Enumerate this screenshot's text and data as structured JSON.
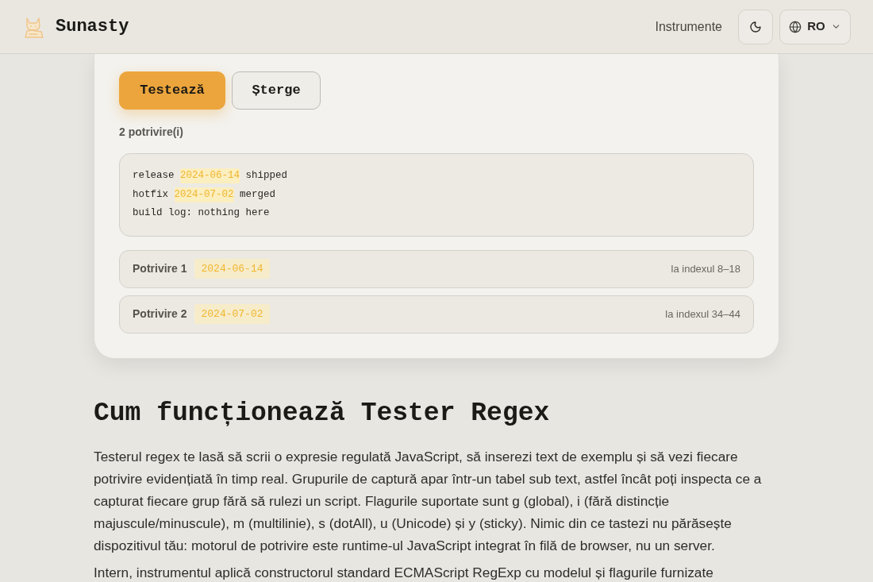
{
  "header": {
    "brand": "Sunasty",
    "nav_link": "Instrumente",
    "language": "RO"
  },
  "actions": [
    {
      "label": "Testează",
      "kind": "primary"
    },
    {
      "label": "Șterge",
      "kind": "secondary"
    }
  ],
  "match_count": "2 potrivire(i)",
  "test_text": [
    [
      {
        "text": "release ",
        "highlighted": false
      },
      {
        "text": "2024-06-14",
        "highlighted": true
      },
      {
        "text": " shipped",
        "highlighted": false
      }
    ],
    [
      {
        "text": "hotfix ",
        "highlighted": false
      },
      {
        "text": "2024-07-02",
        "highlighted": true
      },
      {
        "text": " merged",
        "highlighted": false
      }
    ],
    [
      {
        "text": "build log: nothing here",
        "highlighted": false
      }
    ]
  ],
  "matches": [
    {
      "label": "Potrivire 1",
      "value": "2024-06-14",
      "position": "la indexul 8–18"
    },
    {
      "label": "Potrivire 2",
      "value": "2024-07-02",
      "position": "la indexul 34–44"
    }
  ],
  "article": {
    "heading": "Cum funcționează Tester Regex",
    "paragraphs": [
      "Testerul regex te lasă să scrii o expresie regulată JavaScript, să inserezi text de exemplu și să vezi fiecare potrivire evidențiată în timp real. Grupurile de captură apar într-un tabel sub text, astfel încât poți inspecta ce a capturat fiecare grup fără să rulezi un script. Flagurile suportate sunt g (global), i (fără distincție majuscule/minuscule), m (multilinie), s (dotAll), u (Unicode) și y (sticky). Nimic din ce tastezi nu părăsește dispozitivul tău: motorul de potrivire este runtime-ul JavaScript integrat în filă de browser, nu un server.",
      "Intern, instrumentul aplică constructorul standard ECMAScript RegExp cu modelul și flagurile furnizate"
    ]
  }
}
